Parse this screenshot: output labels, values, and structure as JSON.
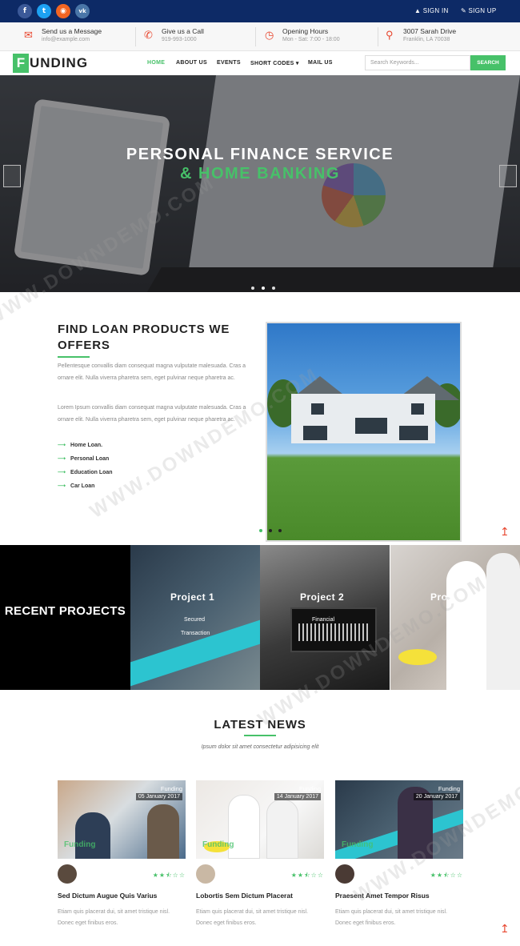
{
  "topbar": {
    "social": [
      {
        "icon": "facebook-icon",
        "glyph": "f"
      },
      {
        "icon": "twitter-icon",
        "glyph": "t"
      },
      {
        "icon": "rss-icon",
        "glyph": "◉"
      },
      {
        "icon": "vk-icon",
        "glyph": "vk"
      }
    ],
    "sign_in": "SIGN IN",
    "sign_up": "SIGN UP"
  },
  "info": [
    {
      "icon": "envelope-icon",
      "title": "Send us a Message",
      "detail": "info@example.com"
    },
    {
      "icon": "phone-icon",
      "title": "Give us a Call",
      "detail": "919-993-1000"
    },
    {
      "icon": "clock-icon",
      "title": "Opening Hours",
      "detail": "Mon - Sat: 7:00 - 18:00"
    },
    {
      "icon": "map-marker-icon",
      "title": "3007 Sarah Drive",
      "detail": "Franklin, LA 70038"
    }
  ],
  "nav": {
    "logo_letter": "F",
    "logo_rest": "UNDING",
    "items": [
      "HOME",
      "ABOUT US",
      "EVENTS",
      "SHORT CODES ▾",
      "MAIL US"
    ],
    "search_placeholder": "Search Keywords...",
    "search_button": "SEARCH"
  },
  "hero": {
    "line1": "PERSONAL FINANCE SERVICE",
    "line2": "& HOME BANKING",
    "slide_count": 3,
    "active_slide": 1
  },
  "loans": {
    "heading": "FIND LOAN PRODUCTS WE OFFERS",
    "para1": "Pellentesque convallis diam consequat magna vulputate malesuada. Cras a ornare elit. Nulla viverra pharetra sem, eget pulvinar neque pharetra ac.",
    "para2": "Lorem Ipsum convallis diam consequat magna vulputate malesuada. Cras a ornare elit. Nulla viverra pharetra sem, eget pulvinar neque pharetra ac.",
    "items": [
      "Home Loan.",
      "Personal Loan",
      "Education Loan",
      "Car Loan"
    ]
  },
  "projects": {
    "heading": "RECENT PROJECTS",
    "items": [
      {
        "title": "Project 1",
        "caption1": "Secured",
        "caption2": "Transaction"
      },
      {
        "title": "Project 2",
        "caption1": "Financial",
        "caption2": ""
      },
      {
        "title": "Project 3",
        "caption1": "",
        "caption2": ""
      }
    ]
  },
  "news": {
    "heading": "LATEST NEWS",
    "subtitle": "Ipsum dolor sit amet consectetur adipisicing elit",
    "cards": [
      {
        "category": "Funding",
        "date": "05 January 2017",
        "title": "Sed Dictum Augue Quis Varius",
        "desc": "Etiam quis placerat dui, sit amet tristique nisl. Donec eget finibus eros.",
        "rating": 2.5
      },
      {
        "category": "Funding",
        "date": "14 January 2017",
        "title": "Lobortis Sem Dictum Placerat",
        "desc": "Etiam quis placerat dui, sit amet tristique nisl. Donec eget finibus eros.",
        "rating": 2.5
      },
      {
        "category": "Funding",
        "date": "20 January 2017",
        "title": "Praesent Amet Tempor Risus",
        "desc": "Etiam quis placerat dui, sit amet tristique nisl. Donec eget finibus eros.",
        "rating": 2.5
      }
    ],
    "stars": "★★⯪☆☆",
    "image_watermark": "Funding"
  },
  "watermark_text": "WWW.DOWNDEMO.COM",
  "colors": {
    "accent": "#47c169",
    "topbar": "#0d2a66",
    "icon_red": "#e8472f"
  }
}
